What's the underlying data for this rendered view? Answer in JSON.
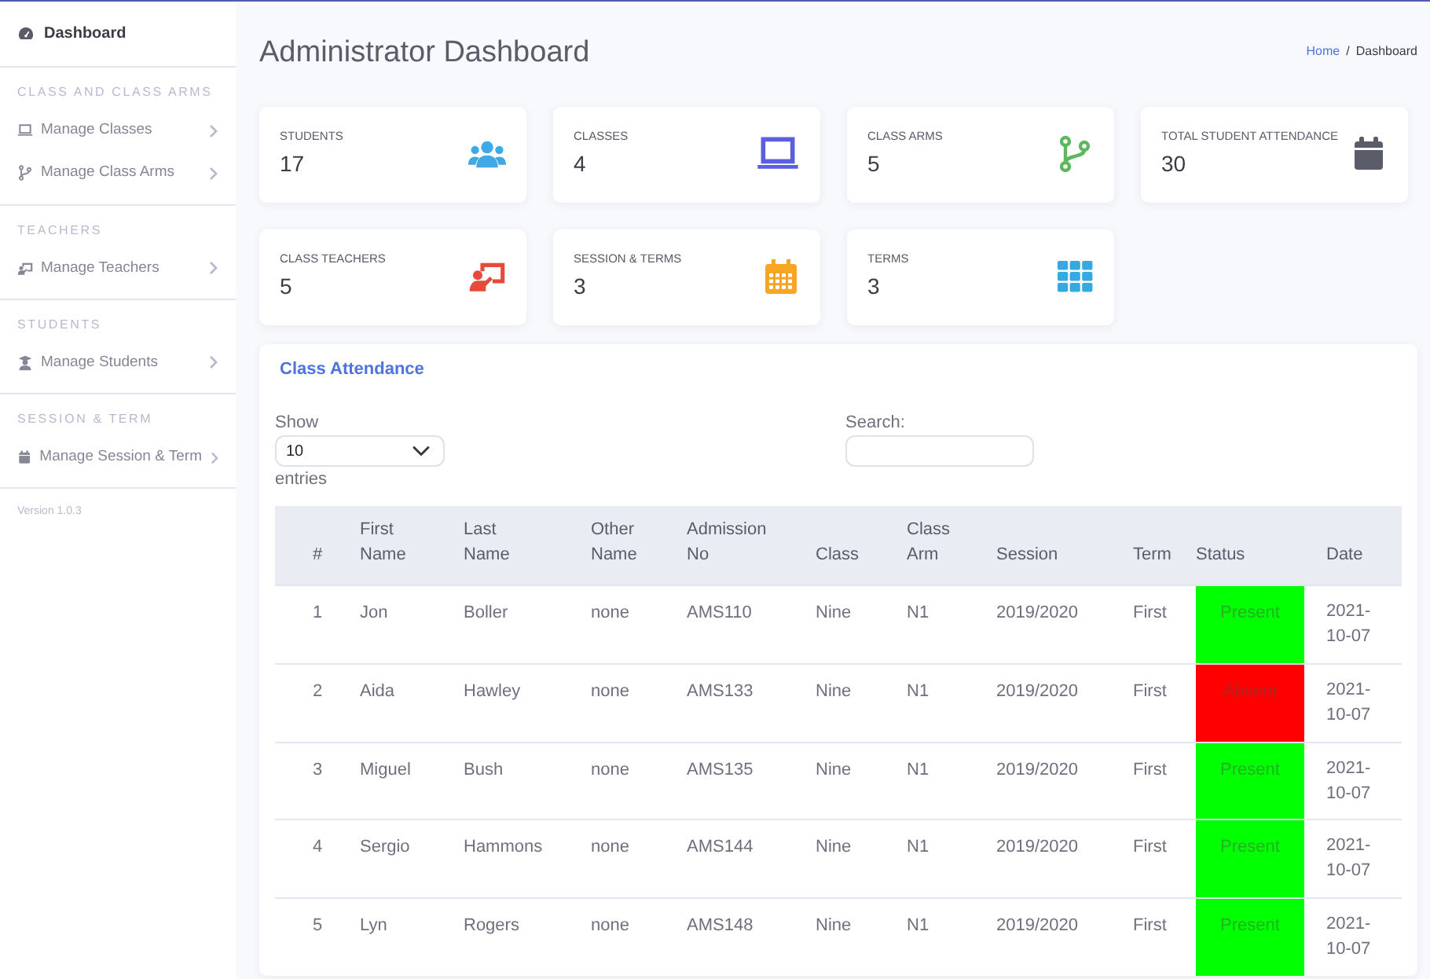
{
  "sidebar": {
    "brand_item": {
      "label": "Dashboard",
      "selected": true
    },
    "sections": [
      {
        "heading": "CLASS AND CLASS ARMS",
        "items": [
          {
            "label": "Manage Classes",
            "kind": "laptop"
          },
          {
            "label": "Manage Class Arms",
            "kind": "branch"
          }
        ]
      },
      {
        "heading": "TEACHERS",
        "items": [
          {
            "label": "Manage Teachers",
            "kind": "teacher"
          }
        ]
      },
      {
        "heading": "STUDENTS",
        "items": [
          {
            "label": "Manage Students",
            "kind": "student"
          }
        ]
      },
      {
        "heading": "SESSION & TERM",
        "items": [
          {
            "label": "Manage Session & Term",
            "kind": "calendar"
          }
        ]
      }
    ],
    "version": "Version 1.0.3"
  },
  "page_title": "Administrator Dashboard",
  "breadcrumb_separator": "/",
  "breadcrumb": [
    {
      "label": "Home",
      "kind": "link"
    },
    {
      "label": "Dashboard",
      "kind": "current"
    }
  ],
  "stats": [
    {
      "label": "STUDENTS",
      "value": "17",
      "kind": "users",
      "color": "#3fa9e8"
    },
    {
      "label": "CLASSES",
      "value": "4",
      "kind": "laptop",
      "color": "#5a5fe0"
    },
    {
      "label": "CLASS ARMS",
      "value": "5",
      "kind": "branch",
      "color": "#5cb85c"
    },
    {
      "label": "TOTAL STUDENT ATTENDANCE",
      "value": "30",
      "kind": "calendar",
      "color": "#5a5c69"
    },
    {
      "label": "CLASS TEACHERS",
      "value": "5",
      "kind": "teacher",
      "color": "#e74a3b"
    },
    {
      "label": "SESSION & TERMS",
      "value": "3",
      "kind": "calendar-grid",
      "color": "#f6a623"
    },
    {
      "label": "TERMS",
      "value": "3",
      "kind": "grid",
      "color": "#36a9e1"
    }
  ],
  "attendance": {
    "title": "Class Attendance",
    "length_label_before": "Show",
    "length_value": "10",
    "length_label_after": "entries",
    "search_label": "Search:",
    "columns": [
      "#",
      "First Name",
      "Last Name",
      "Other Name",
      "Admission No",
      "Class",
      "Class Arm",
      "Session",
      "Term",
      "Status",
      "Date"
    ],
    "rows": [
      {
        "cells": [
          "1",
          "Jon",
          "Boller",
          "none",
          "AMS110",
          "Nine",
          "N1",
          "2019/2020",
          "First",
          "Present",
          "2021-10-07"
        ],
        "color": "#00ff00"
      },
      {
        "cells": [
          "2",
          "Aida",
          "Hawley",
          "none",
          "AMS133",
          "Nine",
          "N1",
          "2019/2020",
          "First",
          "Absent",
          "2021-10-07"
        ],
        "color": "#ff0000"
      },
      {
        "cells": [
          "3",
          "Miguel",
          "Bush",
          "none",
          "AMS135",
          "Nine",
          "N1",
          "2019/2020",
          "First",
          "Present",
          "2021-10-07"
        ],
        "color": "#00ff00"
      },
      {
        "cells": [
          "4",
          "Sergio",
          "Hammons",
          "none",
          "AMS144",
          "Nine",
          "N1",
          "2019/2020",
          "First",
          "Present",
          "2021-10-07"
        ],
        "color": "#00ff00"
      },
      {
        "cells": [
          "5",
          "Lyn",
          "Rogers",
          "none",
          "AMS148",
          "Nine",
          "N1",
          "2019/2020",
          "First",
          "Present",
          "2021-10-07"
        ],
        "color": "#00ff00"
      }
    ]
  }
}
